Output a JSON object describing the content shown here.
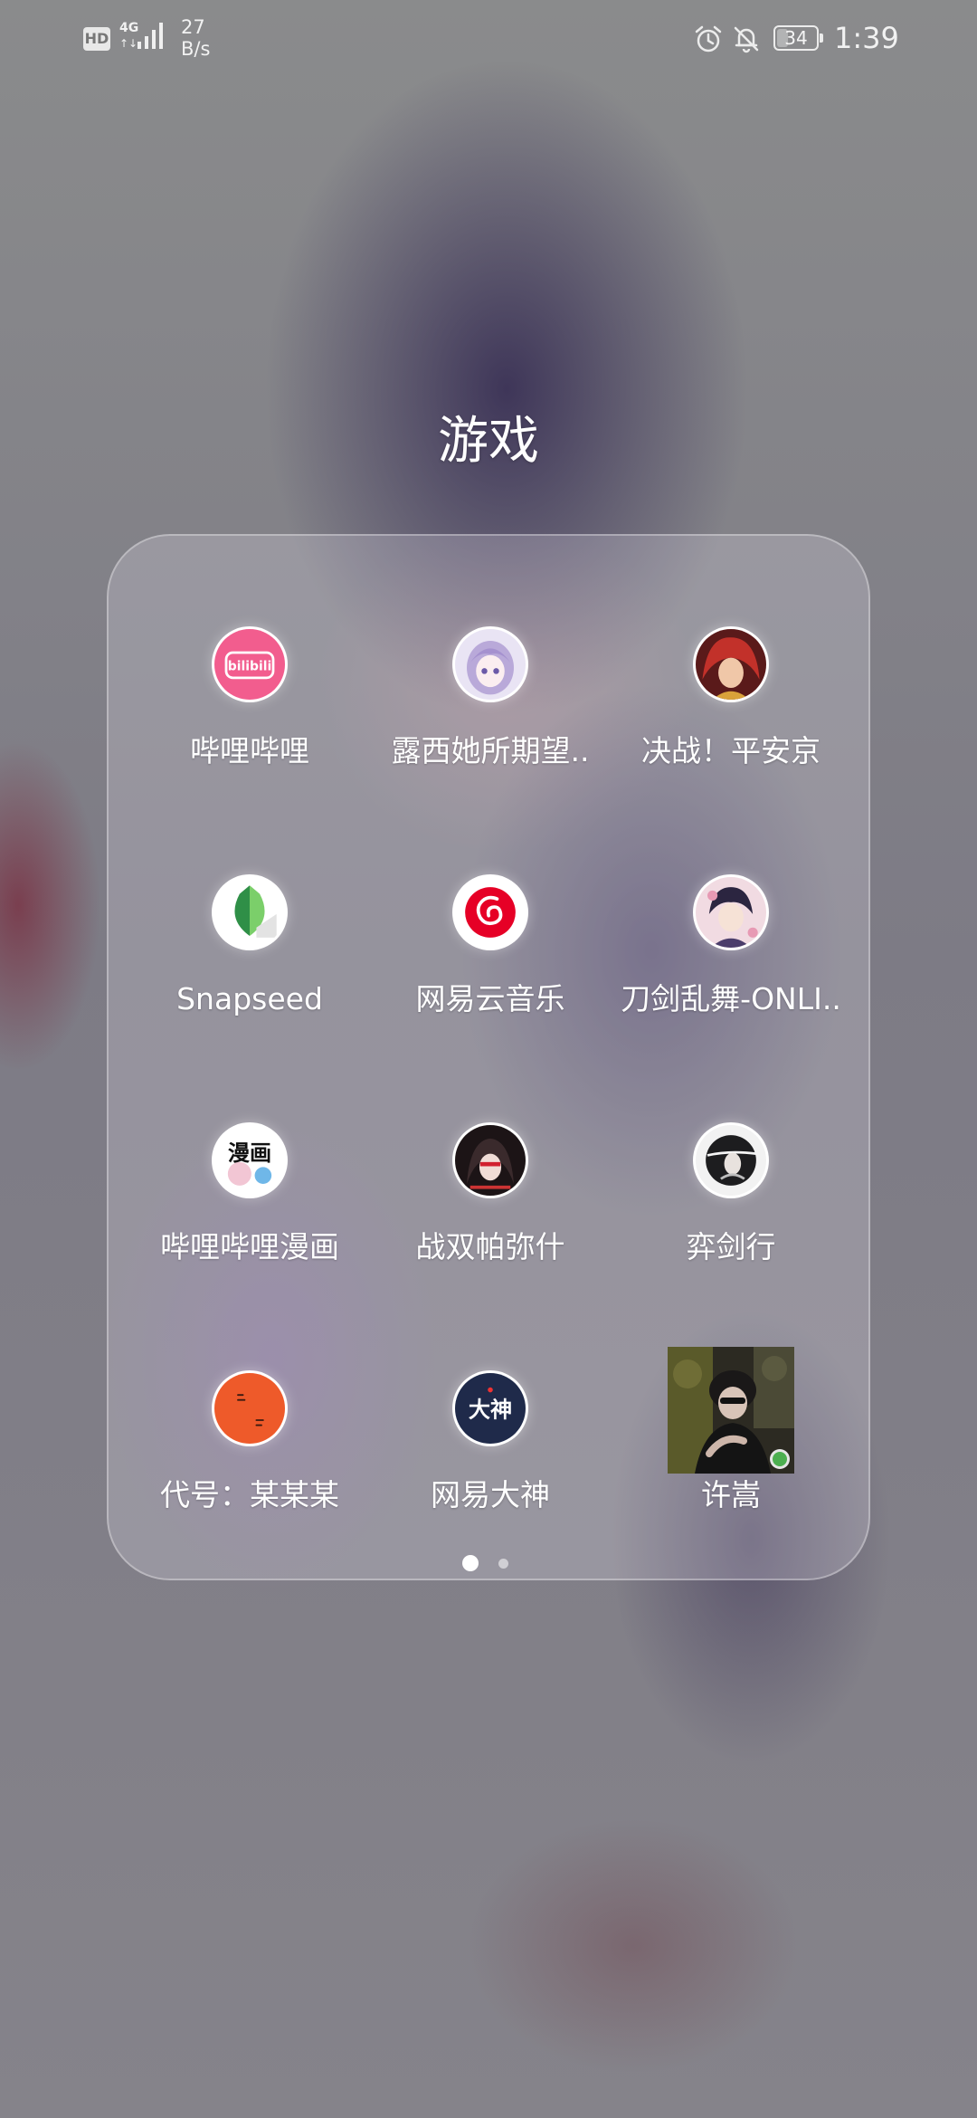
{
  "status_bar": {
    "hd_badge": "HD",
    "network_type": "4G",
    "network_arrows": "↑↓",
    "signal_icon": "signal-bars-icon",
    "speed_value": "27",
    "speed_unit": "B/s",
    "alarm_icon": "alarm-clock-icon",
    "mute_icon": "bell-off-icon",
    "battery_percent": "34",
    "battery_level": 0.34,
    "time": "1:39"
  },
  "folder": {
    "title": "游戏",
    "apps": [
      {
        "label": "哔哩哔哩",
        "icon": "bilibili-icon"
      },
      {
        "label": "露西她所期望..",
        "icon": "anime-girl-icon"
      },
      {
        "label": "决战！平安京",
        "icon": "red-hair-character-icon"
      },
      {
        "label": "Snapseed",
        "icon": "snapseed-leaf-icon"
      },
      {
        "label": "网易云音乐",
        "icon": "netease-music-icon"
      },
      {
        "label": "刀剑乱舞-ONLI..",
        "icon": "samurai-character-icon"
      },
      {
        "label": "哔哩哔哩漫画",
        "icon": "bilibili-comics-icon",
        "icon_text": "漫画"
      },
      {
        "label": "战双帕弥什",
        "icon": "punishing-character-icon"
      },
      {
        "label": "弈剑行",
        "icon": "swordsman-ink-icon"
      },
      {
        "label": "代号：某某某",
        "icon": "codename-orange-icon"
      },
      {
        "label": "网易大神",
        "icon": "netease-dashen-icon",
        "icon_text": "大神"
      },
      {
        "label": "许嵩",
        "icon": "contact-photo-icon"
      }
    ],
    "page_count": 2,
    "current_page": 1
  },
  "colors": {
    "bilibili_pink": "#f25d8e",
    "netease_red": "#e60026",
    "snapseed_green": "#3aa757",
    "dashen_navy": "#1f2a4a",
    "codename_orange": "#ee5a2a"
  }
}
